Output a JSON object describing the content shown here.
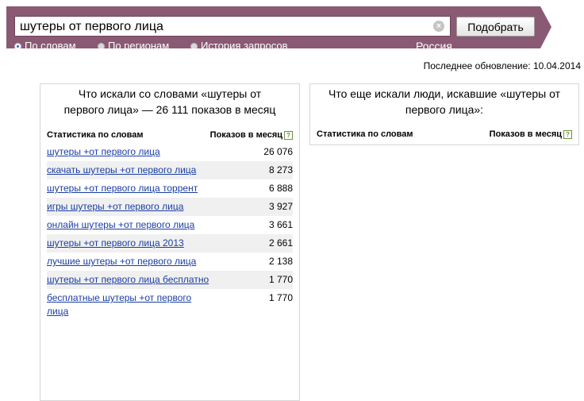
{
  "search": {
    "query": "шутеры от первого лица",
    "submit_label": "Подобрать",
    "modes": [
      {
        "label": "По словам",
        "checked": true
      },
      {
        "label": "По регионам",
        "checked": false
      },
      {
        "label": "История запросов",
        "checked": false
      }
    ],
    "region": "Россия"
  },
  "last_update": "Последнее обновление: 10.04.2014",
  "left_panel": {
    "title_line1": "Что искали со словами «шутеры от",
    "title_line2": "первого лица» — 26 111 показов в месяц",
    "col_stats": "Статистика по словам",
    "col_shows": "Показов в месяц",
    "rows": [
      {
        "query": "шутеры +от первого лица",
        "shows": "26 076"
      },
      {
        "query": "скачать шутеры +от первого лица",
        "shows": "8 273"
      },
      {
        "query": "шутеры +от первого лица торрент",
        "shows": "6 888"
      },
      {
        "query": "игры шутеры +от первого лица",
        "shows": "3 927"
      },
      {
        "query": "онлайн шутеры +от первого лица",
        "shows": "3 661"
      },
      {
        "query": "шутеры +от первого лица 2013",
        "shows": "2 661"
      },
      {
        "query": "лучшие шутеры +от первого лица",
        "shows": "2 138"
      },
      {
        "query": "шутеры +от первого лица бесплатно",
        "shows": "1 770"
      },
      {
        "query": "бесплатные шутеры +от первого лица",
        "shows": "1 770"
      }
    ]
  },
  "right_panel": {
    "title_line1": "Что еще искали люди, искавшие «шутеры от",
    "title_line2": "первого лица»:",
    "col_stats": "Статистика по словам",
    "col_shows": "Показов в месяц"
  },
  "colors": {
    "bar": "#8a5a74",
    "link": "#1a3ea3",
    "row_alt": "#f0f0f0"
  }
}
